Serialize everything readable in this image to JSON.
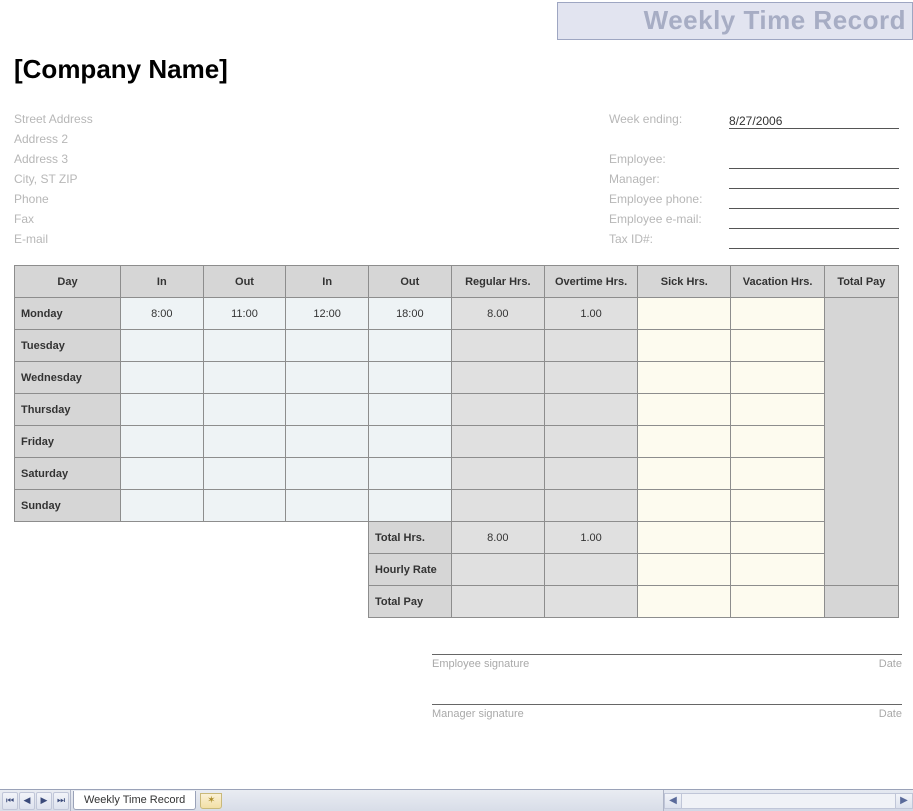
{
  "title": "Weekly Time Record",
  "company": "[Company Name]",
  "address": {
    "street": "Street Address",
    "address2": "Address 2",
    "address3": "Address 3",
    "city": "City, ST  ZIP",
    "phone": "Phone",
    "fax": "Fax",
    "email": "E-mail"
  },
  "meta": {
    "week_ending_label": "Week ending:",
    "week_ending_value": "8/27/2006",
    "employee_label": "Employee:",
    "employee_value": "",
    "manager_label": "Manager:",
    "manager_value": "",
    "emp_phone_label": "Employee phone:",
    "emp_phone_value": "",
    "emp_email_label": "Employee e-mail:",
    "emp_email_value": "",
    "tax_label": "Tax ID#:",
    "tax_value": ""
  },
  "headers": {
    "day": "Day",
    "in1": "In",
    "out1": "Out",
    "in2": "In",
    "out2": "Out",
    "reg": "Regular Hrs.",
    "ot": "Overtime Hrs.",
    "sick": "Sick Hrs.",
    "vac": "Vacation Hrs.",
    "total": "Total Pay"
  },
  "rows": [
    {
      "day": "Monday",
      "in1": "8:00",
      "out1": "11:00",
      "in2": "12:00",
      "out2": "18:00",
      "reg": "8.00",
      "ot": "1.00",
      "sick": "",
      "vac": ""
    },
    {
      "day": "Tuesday",
      "in1": "",
      "out1": "",
      "in2": "",
      "out2": "",
      "reg": "",
      "ot": "",
      "sick": "",
      "vac": ""
    },
    {
      "day": "Wednesday",
      "in1": "",
      "out1": "",
      "in2": "",
      "out2": "",
      "reg": "",
      "ot": "",
      "sick": "",
      "vac": ""
    },
    {
      "day": "Thursday",
      "in1": "",
      "out1": "",
      "in2": "",
      "out2": "",
      "reg": "",
      "ot": "",
      "sick": "",
      "vac": ""
    },
    {
      "day": "Friday",
      "in1": "",
      "out1": "",
      "in2": "",
      "out2": "",
      "reg": "",
      "ot": "",
      "sick": "",
      "vac": ""
    },
    {
      "day": "Saturday",
      "in1": "",
      "out1": "",
      "in2": "",
      "out2": "",
      "reg": "",
      "ot": "",
      "sick": "",
      "vac": ""
    },
    {
      "day": "Sunday",
      "in1": "",
      "out1": "",
      "in2": "",
      "out2": "",
      "reg": "",
      "ot": "",
      "sick": "",
      "vac": ""
    }
  ],
  "summary": {
    "total_hrs_label": "Total Hrs.",
    "total_reg": "8.00",
    "total_ot": "1.00",
    "total_sick": "",
    "total_vac": "",
    "hourly_rate_label": "Hourly Rate",
    "total_pay_label": "Total Pay"
  },
  "signatures": {
    "employee": "Employee signature",
    "manager": "Manager signature",
    "date": "Date"
  },
  "tab": {
    "name": "Weekly Time Record"
  }
}
